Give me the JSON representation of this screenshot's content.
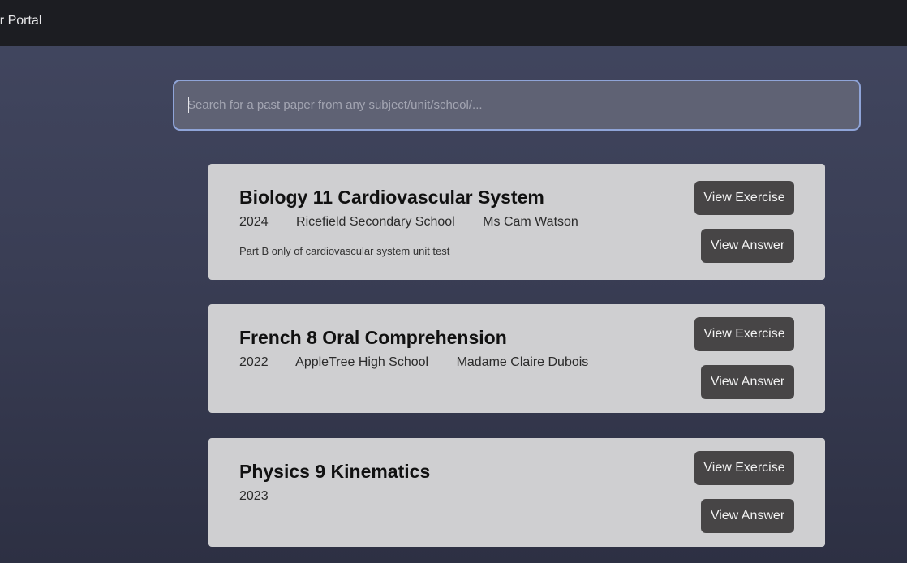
{
  "header": {
    "title": "Past Paper Portal",
    "visible_title": "per Portal"
  },
  "search": {
    "placeholder": "Search for a past paper from any subject/unit/school/...",
    "value": ""
  },
  "papers": [
    {
      "title": "Biology 11 Cardiovascular System",
      "year": "2024",
      "school": "Ricefield Secondary School",
      "teacher": "Ms Cam Watson",
      "description": "Part B only of cardiovascular system unit test",
      "view_exercise_label": "View Exercise",
      "view_answer_label": "View Answer"
    },
    {
      "title": "French 8 Oral Comprehension",
      "year": "2022",
      "school": "AppleTree High School",
      "teacher": "Madame Claire Dubois",
      "description": "",
      "view_exercise_label": "View Exercise",
      "view_answer_label": "View Answer"
    },
    {
      "title": "Physics 9 Kinematics",
      "year": "2023",
      "school": "",
      "teacher": "",
      "description": "",
      "view_exercise_label": "View Exercise",
      "view_answer_label": "View Answer"
    }
  ],
  "colors": {
    "topbar": "#1c1d22",
    "card": "#cfcfd1",
    "button": "#474546",
    "search_border": "#8fa4d8"
  }
}
